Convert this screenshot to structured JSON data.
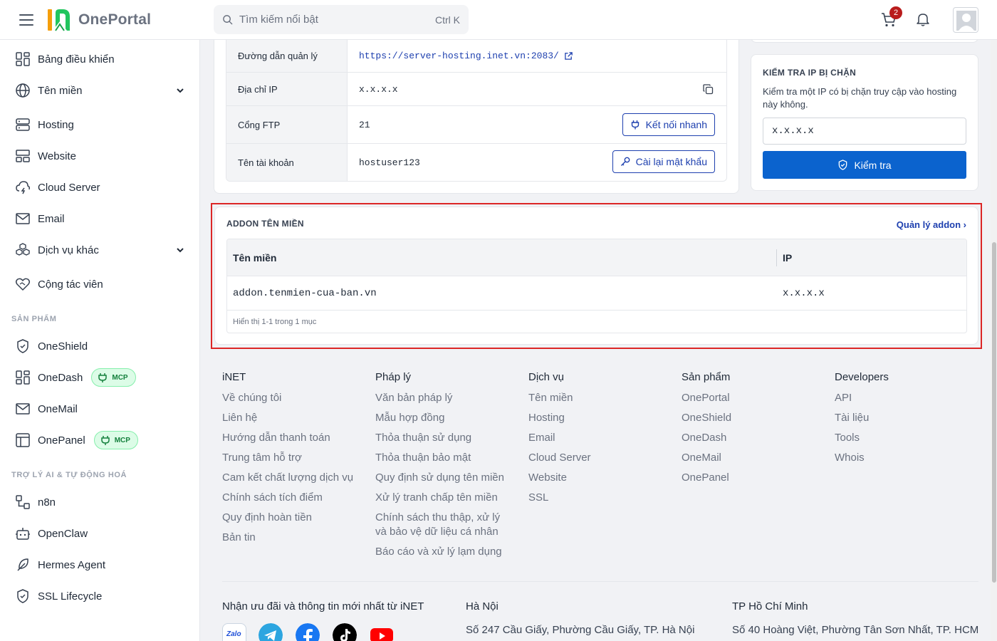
{
  "header": {
    "logo_text": "OnePortal",
    "search_placeholder": "Tìm kiếm nổi bật",
    "search_shortcut": "Ctrl K",
    "cart_count": "2"
  },
  "sidebar": {
    "items_main": [
      {
        "label": "Bảng điều khiển"
      },
      {
        "label": "Tên miền"
      },
      {
        "label": "Hosting"
      },
      {
        "label": "Website"
      },
      {
        "label": "Cloud Server"
      },
      {
        "label": "Email"
      },
      {
        "label": "Dịch vụ khác"
      },
      {
        "label": "Cộng tác viên"
      }
    ],
    "section_products": "SẢN PHẨM",
    "items_products": [
      {
        "label": "OneShield"
      },
      {
        "label": "OneDash",
        "badge": "MCP"
      },
      {
        "label": "OneMail"
      },
      {
        "label": "OnePanel",
        "badge": "MCP"
      }
    ],
    "section_ai": "TRỢ LÝ AI & TỰ ĐỘNG HOÁ",
    "items_ai": [
      {
        "label": "n8n"
      },
      {
        "label": "OpenClaw"
      },
      {
        "label": "Hermes Agent"
      },
      {
        "label": "SSL Lifecycle"
      }
    ]
  },
  "account_info": {
    "rows": [
      {
        "label": "Đường dẫn quản lý",
        "value": "https://server-hosting.inet.vn:2083/"
      },
      {
        "label": "Địa chỉ IP",
        "value": "x.x.x.x"
      },
      {
        "label": "Cổng FTP",
        "value": "21",
        "action": "Kết nối nhanh"
      },
      {
        "label": "Tên tài khoản",
        "value": "hostuser123",
        "action": "Cài lại mật khẩu"
      }
    ]
  },
  "ip_check": {
    "title": "KIỂM TRA IP BỊ CHẶN",
    "description": "Kiểm tra một IP có bị chặn truy cập vào hosting này không.",
    "input_value": "x.x.x.x",
    "button_label": "Kiểm tra"
  },
  "addon": {
    "title": "ADDON TÊN MIỀN",
    "manage_link": "Quản lý addon ›",
    "columns": [
      "Tên miền",
      "IP"
    ],
    "rows": [
      {
        "domain": "addon.tenmien-cua-ban.vn",
        "ip": "x.x.x.x"
      }
    ],
    "footer": "Hiển thị 1-1 trong 1 mục"
  },
  "footer": {
    "columns": [
      {
        "title": "iNET",
        "links": [
          "Về chúng tôi",
          "Liên hệ",
          "Hướng dẫn thanh toán",
          "Trung tâm hỗ trợ",
          "Cam kết chất lượng dịch vụ",
          "Chính sách tích điểm",
          "Quy định hoàn tiền",
          "Bản tin"
        ]
      },
      {
        "title": "Pháp lý",
        "links": [
          "Văn bản pháp lý",
          "Mẫu hợp đồng",
          "Thỏa thuận sử dụng",
          "Thỏa thuận bảo mật",
          "Quy định sử dụng tên miền",
          "Xử lý tranh chấp tên miền",
          "Chính sách thu thập, xử lý và bảo vệ dữ liệu cá nhân",
          "Báo cáo và xử lý lạm dụng"
        ]
      },
      {
        "title": "Dịch vụ",
        "links": [
          "Tên miền",
          "Hosting",
          "Email",
          "Cloud Server",
          "Website",
          "SSL"
        ]
      },
      {
        "title": "Sản phẩm",
        "links": [
          "OnePortal",
          "OneShield",
          "OneDash",
          "OneMail",
          "OnePanel"
        ]
      },
      {
        "title": "Developers",
        "links": [
          "API",
          "Tài liệu",
          "Tools",
          "Whois"
        ]
      }
    ],
    "newsletter_title": "Nhận ưu đãi và thông tin mới nhất từ iNET",
    "hanoi_title": "Hà Nội",
    "hanoi_address": "Số 247 Cầu Giấy, Phường Cầu Giấy, TP. Hà Nội",
    "hcm_title": "TP Hồ Chí Minh",
    "hcm_address": "Số 40 Hoàng Việt, Phường Tân Sơn Nhất, TP. HCM",
    "social": [
      {
        "name": "zalo-icon",
        "label": "Zalo"
      },
      {
        "name": "telegram-icon"
      },
      {
        "name": "facebook-icon"
      },
      {
        "name": "tiktok-icon"
      },
      {
        "name": "youtube-icon"
      }
    ]
  },
  "colors": {
    "primary": "#0b63ce",
    "link": "#1e40af",
    "highlight": "#dc2626",
    "badge_bg": "#dcfce7",
    "badge_text": "#15803d",
    "cart_badge": "#b91c1c"
  }
}
